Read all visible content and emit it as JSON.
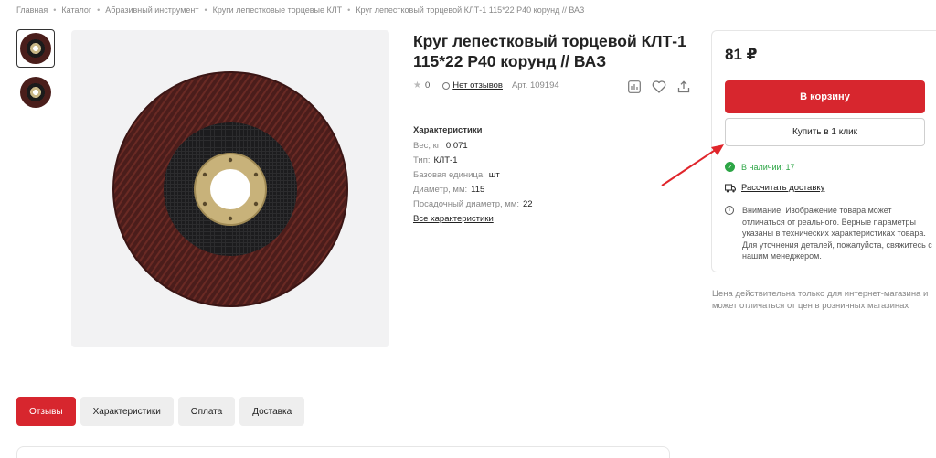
{
  "breadcrumb": [
    "Главная",
    "Каталог",
    "Абразивный инструмент",
    "Круги лепестковые торцевые КЛТ",
    "Круг лепестковый торцевой КЛТ-1 115*22 P40 корунд // ВАЗ"
  ],
  "product": {
    "title": "Круг лепестковый торцевой КЛТ-1 115*22 P40 корунд // ВАЗ",
    "rating": "0",
    "reviews": "Нет отзывов",
    "article": "Арт. 109194"
  },
  "specs": {
    "title": "Характеристики",
    "rows": [
      {
        "key": "Вес, кг:",
        "value": "0,071"
      },
      {
        "key": "Тип:",
        "value": "КЛТ-1"
      },
      {
        "key": "Базовая единица:",
        "value": "шт"
      },
      {
        "key": "Диаметр, мм:",
        "value": "115"
      },
      {
        "key": "Посадочный диаметр, мм:",
        "value": "22"
      }
    ],
    "all_link": "Все характеристики"
  },
  "buy": {
    "price": "81 ₽",
    "cart_button": "В корзину",
    "oneclick_button": "Купить в 1 клик",
    "stock": "В наличии: 17",
    "delivery": "Рассчитать доставку",
    "notice": "Внимание! Изображение товара может отличаться от реального. Верные параметры указаны в технических характеристиках товара. Для уточнения деталей, пожалуйста, свяжитесь с нашим менеджером."
  },
  "price_note": "Цена действительна только для интернет-магазина и может отличаться от цен в розничных магазинах",
  "tabs": [
    "Отзывы",
    "Характеристики",
    "Оплата",
    "Доставка"
  ],
  "colors": {
    "accent": "#d7262e",
    "stock": "#2ca545"
  },
  "icons": {
    "actions": [
      "compare-icon",
      "heart-icon",
      "share-icon"
    ]
  }
}
